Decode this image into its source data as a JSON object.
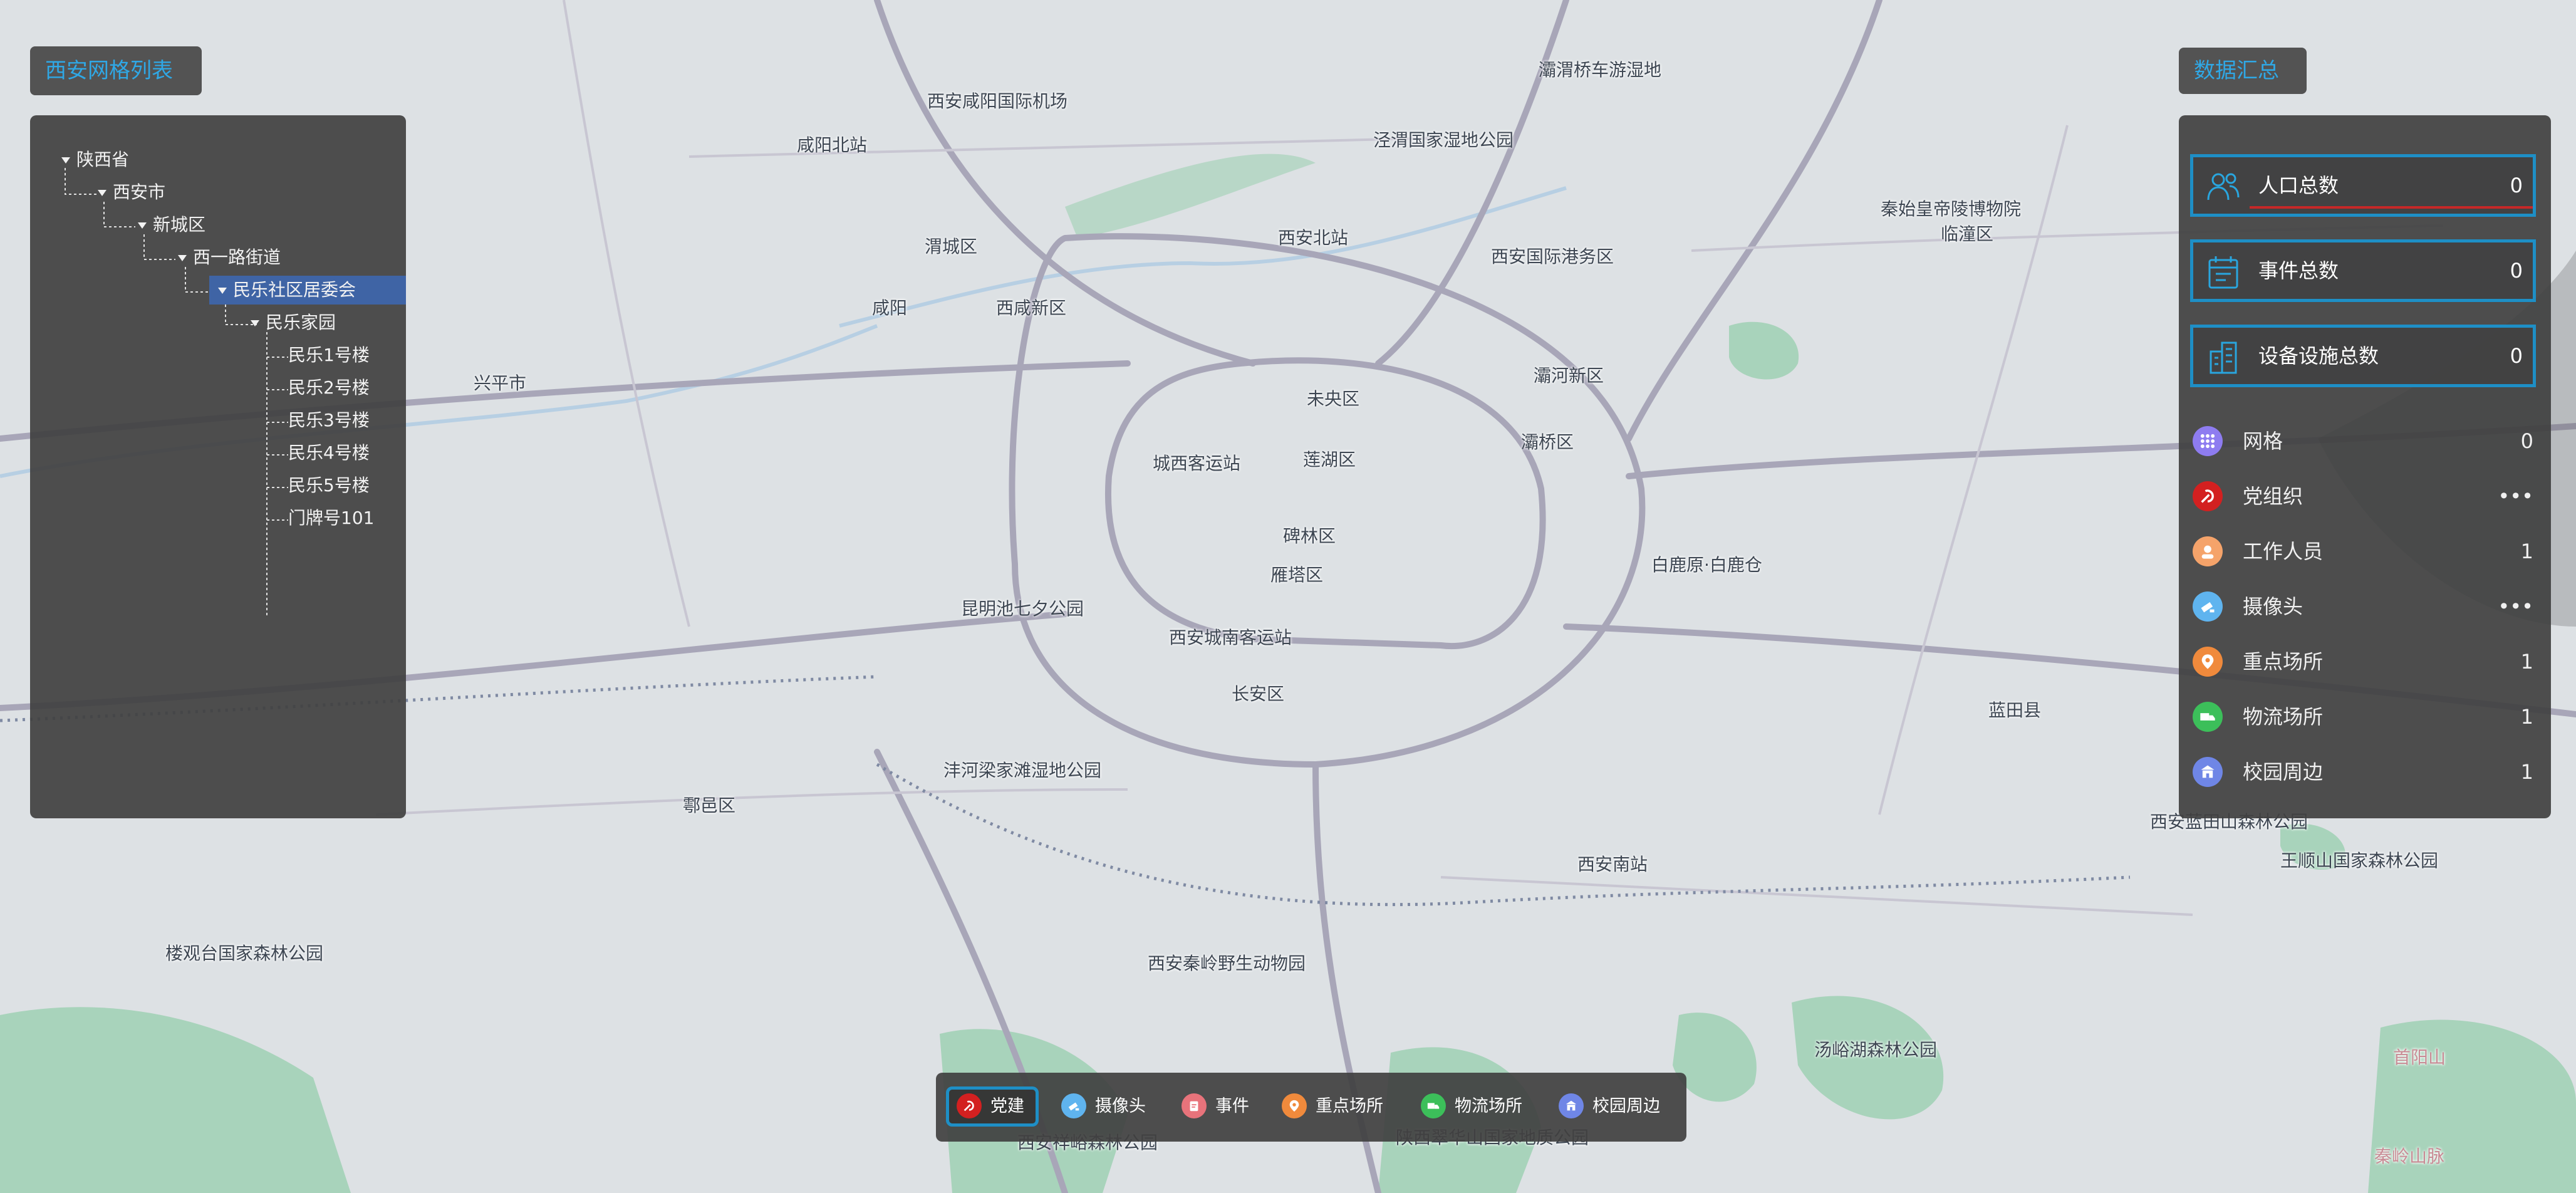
{
  "left_panel": {
    "title": "西安网格列表",
    "tree": [
      {
        "label": "陕西省"
      },
      {
        "label": "西安市"
      },
      {
        "label": "新城区"
      },
      {
        "label": "西一路街道"
      },
      {
        "label": "民乐社区居委会",
        "selected": true
      },
      {
        "label": "民乐家园"
      },
      {
        "label": "民乐1号楼"
      },
      {
        "label": "民乐2号楼"
      },
      {
        "label": "民乐3号楼"
      },
      {
        "label": "民乐4号楼"
      },
      {
        "label": "民乐5号楼"
      },
      {
        "label": "门牌号101"
      }
    ]
  },
  "right_panel": {
    "title": "数据汇总",
    "cards": [
      {
        "label": "人口总数",
        "value": "0",
        "icon": "people-icon"
      },
      {
        "label": "事件总数",
        "value": "0",
        "icon": "calendar-icon"
      },
      {
        "label": "设备设施总数",
        "value": "0",
        "icon": "building-icon"
      }
    ],
    "stats": [
      {
        "label": "网格",
        "value": "0",
        "icon": "grid-icon",
        "color": "#8e7cf0"
      },
      {
        "label": "党组织",
        "value": "•••",
        "icon": "party-icon",
        "color": "#d32020"
      },
      {
        "label": "工作人员",
        "value": "1",
        "icon": "staff-icon",
        "color": "#f5a36a"
      },
      {
        "label": "摄像头",
        "value": "•••",
        "icon": "camera-icon",
        "color": "#5fb4ef"
      },
      {
        "label": "重点场所",
        "value": "1",
        "icon": "location-icon",
        "color": "#f08a3c"
      },
      {
        "label": "物流场所",
        "value": "1",
        "icon": "truck-icon",
        "color": "#3cbf5a"
      },
      {
        "label": "校园周边",
        "value": "1",
        "icon": "school-icon",
        "color": "#6f86e6"
      }
    ]
  },
  "bottom_bar": {
    "items": [
      {
        "label": "党建",
        "icon": "party-icon",
        "color": "#d32020",
        "active": true
      },
      {
        "label": "摄像头",
        "icon": "camera-icon",
        "color": "#5fb4ef"
      },
      {
        "label": "事件",
        "icon": "event-icon",
        "color": "#e8737b"
      },
      {
        "label": "重点场所",
        "icon": "location-icon",
        "color": "#f08a3c"
      },
      {
        "label": "物流场所",
        "icon": "truck-icon",
        "color": "#3cbf5a"
      },
      {
        "label": "校园周边",
        "icon": "school-icon",
        "color": "#6f86e6"
      }
    ]
  },
  "map": {
    "labels": [
      "西安咸阳国际机场",
      "灞渭桥车游湿地",
      "泾渭国家湿地公园",
      "咸阳北站",
      "秦始皇帝陵博物院",
      "西安北站",
      "西安国际港务区",
      "渭城区",
      "临潼区",
      "咸阳",
      "西咸新区",
      "灞河新区",
      "兴平市",
      "未央区",
      "城西客运站",
      "莲湖区",
      "灞桥区",
      "碑林区",
      "雁塔区",
      "白鹿原·白鹿仓",
      "昆明池七夕公园",
      "西安城南客运站",
      "长安区",
      "蓝田县",
      "沣河梁家滩湿地公园",
      "鄠邑区",
      "西安南站",
      "西安蓝田山森林公园",
      "王顺山国家森林公园",
      "楼观台国家森林公园",
      "西安秦岭野生动物园",
      "汤峪湖森林公园",
      "西安祥峪森林公园",
      "陕西翠华山国家地质公园",
      "首阳山",
      "秦岭山脉"
    ]
  }
}
